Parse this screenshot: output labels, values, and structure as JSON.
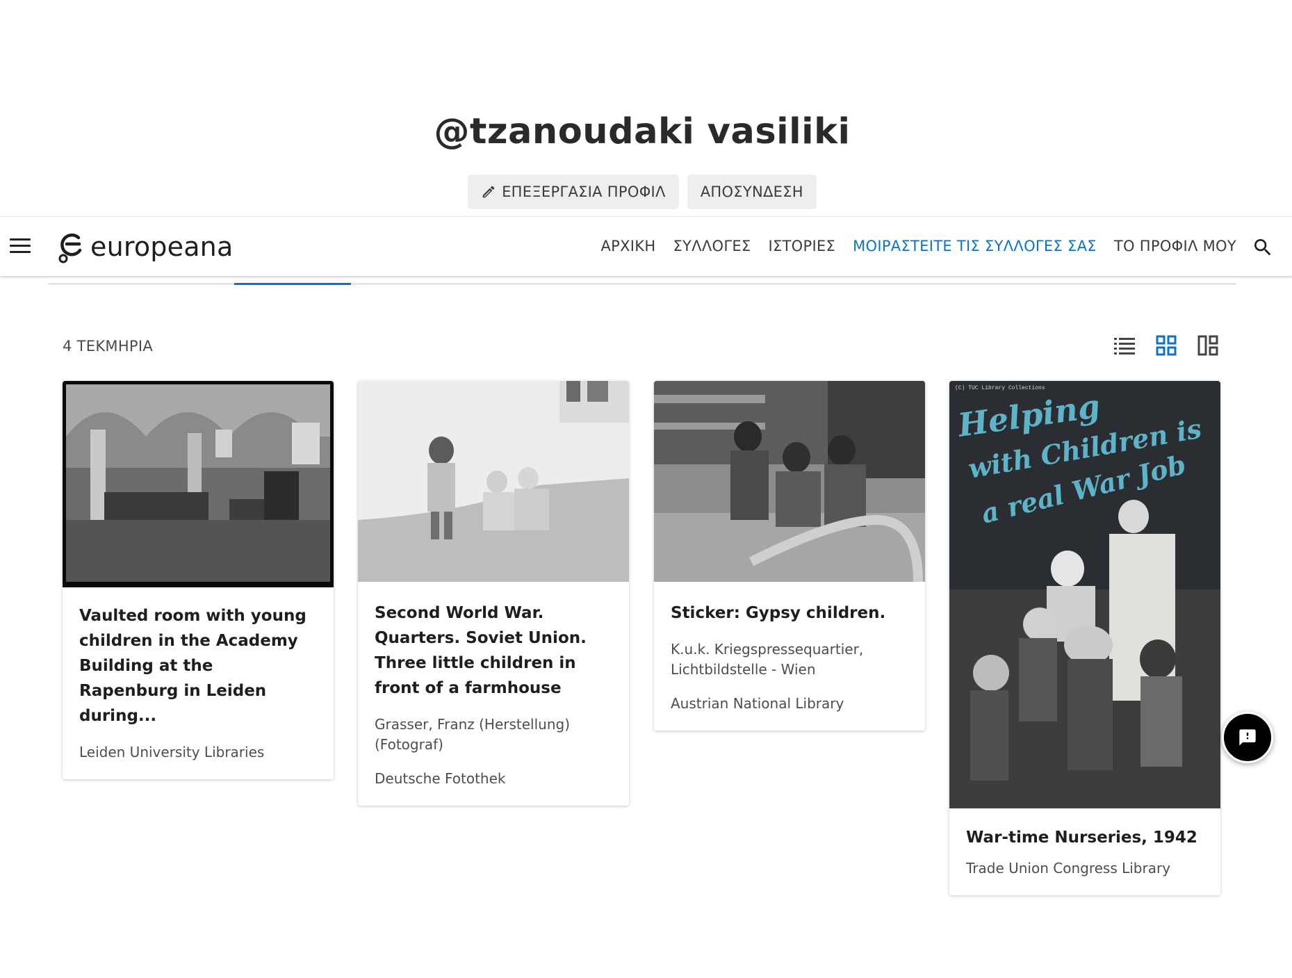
{
  "profile": {
    "name": "@tzanoudaki vasiliki",
    "edit_label": "ΕΠΕΞΕΡΓΑΣΙΑ ΠΡΟΦΙΛ",
    "logout_label": "ΑΠΟΣΥΝΔΕΣΗ"
  },
  "header": {
    "logo_text": "europeana",
    "nav": [
      {
        "label": "ΑΡΧΙΚΗ"
      },
      {
        "label": "ΣΥΛΛΟΓΕΣ"
      },
      {
        "label": "ΙΣΤΟΡΙΕΣ"
      },
      {
        "label": "ΜΟΙΡΑΣΤΕΙΤΕ ΤΙΣ ΣΥΛΛΟΓΕΣ ΣΑΣ"
      },
      {
        "label": "ΤΟ ΠΡΟΦΙΛ ΜΟΥ"
      }
    ],
    "accent_color": "#0a72cc"
  },
  "results": {
    "count_label": "4 ΤΕΚΜΗΡΙΑ",
    "view_modes": [
      "list-view-icon",
      "grid-view-icon",
      "mosaic-view-icon"
    ],
    "selected_view": "grid"
  },
  "cards": [
    {
      "title": "Vaulted room with young children in the Academy Building at the Rapenburg in Leiden during...",
      "creator": "",
      "provider": "Leiden University Libraries"
    },
    {
      "title": "Second World War. Quarters. Soviet Union. Three little children in front of a farmhouse",
      "creator": "Grasser, Franz (Herstellung) (Fotograf)",
      "provider": "Deutsche Fotothek"
    },
    {
      "title": "Sticker: Gypsy children.",
      "creator": "K.u.k. Kriegspressequartier, Lichtbildstelle - Wien",
      "provider": "Austrian National Library"
    },
    {
      "title": "War-time Nurseries, 1942",
      "creator": "",
      "provider": "Trade Union Congress Library",
      "poster_caption": "(C) TUC Library Collections",
      "poster_text": [
        "Helping",
        "with Children is",
        "a real War Job"
      ]
    }
  ]
}
